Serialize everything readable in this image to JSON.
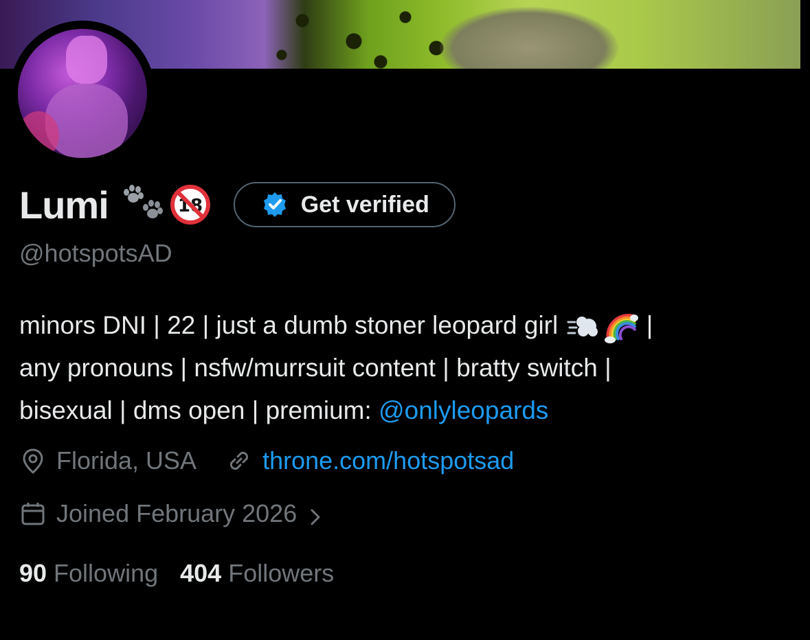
{
  "profile": {
    "display_name": "Lumi",
    "name_emojis": [
      "paw-prints",
      "no-one-under-eighteen"
    ],
    "handle": "@hotspotsAD",
    "verify_button_label": "Get verified",
    "bio": {
      "line1": "minors DNI | 22 | just a dumb stoner leopard girl",
      "line1_emojis": [
        "dashing-away",
        "rainbow"
      ],
      "line1_end": " |",
      "line2": "any pronouns | nsfw/murrsuit content | bratty switch |",
      "line3_prefix": "bisexual | dms open | premium: ",
      "line3_link": "@onlyleopards"
    },
    "location": "Florida, USA",
    "website": "throne.com/hotspotsad",
    "joined": "Joined February 2026",
    "following_count": "90",
    "following_label": "Following",
    "followers_count": "404",
    "followers_label": "Followers"
  },
  "colors": {
    "background": "#000000",
    "text_primary": "#e7e9ea",
    "text_secondary": "#71767b",
    "link": "#1d9bf0",
    "border": "#536471",
    "verified_badge": "#1d9bf0"
  }
}
